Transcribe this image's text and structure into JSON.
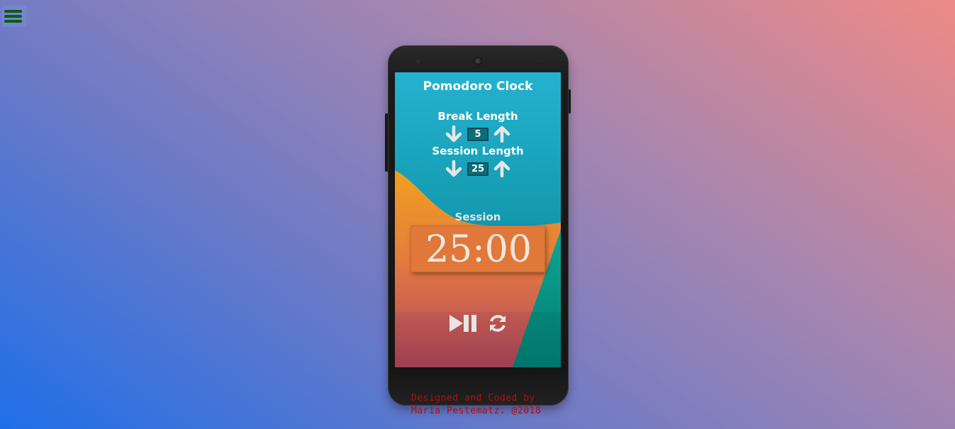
{
  "menu": {
    "icon": "hamburger-menu-icon",
    "icon_color": "#0d5a12"
  },
  "clock": {
    "title": "Pomodoro Clock",
    "break": {
      "label": "Break Length",
      "value": "5",
      "decrease_icon": "arrow-down-icon",
      "increase_icon": "arrow-up-icon"
    },
    "session": {
      "label": "Session Length",
      "value": "25",
      "decrease_icon": "arrow-down-icon",
      "increase_icon": "arrow-up-icon"
    },
    "mode": "Session",
    "time": "25:00",
    "controls": {
      "play_pause_icon": "play-pause-icon",
      "reset_icon": "refresh-icon"
    }
  },
  "footer": {
    "line1": "Designed and Coded by",
    "line2": "Maria Pestematz. @2018"
  },
  "colors": {
    "accent": "#e0783a",
    "screen_teal": "#008b9a",
    "footer_text": "#b30d0d"
  }
}
